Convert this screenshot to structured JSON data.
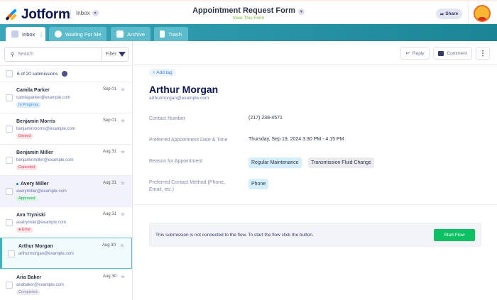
{
  "header": {
    "logo": "Jotform",
    "inbox_label": "Inbox",
    "form_title": "Appointment Request Form",
    "view_form": "View This Form",
    "share_label": "Share"
  },
  "tabs": [
    {
      "label": "Inbox"
    },
    {
      "label": "Waiting For Me"
    },
    {
      "label": "Archive"
    },
    {
      "label": "Trash"
    }
  ],
  "sidebar": {
    "search_placeholder": "Search",
    "filter_label": "Filter",
    "count_text": "6 of 20 submissions",
    "items": [
      {
        "name": "Camila Parker",
        "email": "camilaparker@example.com",
        "date": "Sep 01",
        "status": "In Progress",
        "status_bg": "#dcecfd",
        "status_color": "#4a8fe6"
      },
      {
        "name": "Benjamin Morris",
        "email": "benjaminmorris@example.com",
        "date": "Sep 01",
        "status": "Denied",
        "status_bg": "#fde3e6",
        "status_color": "#d94456"
      },
      {
        "name": "Benjamin Miller",
        "email": "benjaminmiller@example.com",
        "date": "Aug 31",
        "status": "Canceled",
        "status_bg": "#fde3e6",
        "status_color": "#d94456"
      },
      {
        "name": "Avery Miller",
        "email": "averymiller@example.com",
        "date": "Aug 31",
        "status": "Approved",
        "status_bg": "#d9f6e6",
        "status_color": "#1ea35a"
      },
      {
        "name": "Ava Tryniski",
        "email": "avatryniski@example.com",
        "date": "Aug 31",
        "status": "Error",
        "status_bg": "#fde3e6",
        "status_color": "#d94456"
      },
      {
        "name": "Arthur Morgan",
        "email": "arthurmorgan@example.com",
        "date": "Aug 30",
        "status": ""
      },
      {
        "name": "Aria Baker",
        "email": "ariabaker@example.com",
        "date": "Aug 30",
        "status": "Completed",
        "status_bg": "#ececf0",
        "status_color": "#8d8fa8"
      }
    ]
  },
  "toolbar": {
    "reply": "Reply",
    "comment": "Comment"
  },
  "detail": {
    "add_tag": "+ Add tag",
    "name": "Arthur Morgan",
    "email": "arthurmorgan@example.com",
    "fields": [
      {
        "label": "Contact Number",
        "value": "(217) 238-4571"
      },
      {
        "label": "Preferred Appointment Date & Time",
        "value": "Thursday, Sep 19, 2024 3:30 PM - 4:15 PM"
      },
      {
        "label": "Reason for Appointment",
        "chips": [
          "Regular Maintenance",
          "Transmission Fluid Change"
        ]
      },
      {
        "label": "Preferred Contact Method (Phone, Email, etc.)",
        "chips": [
          "Phone"
        ]
      }
    ],
    "flow_text": "This submission is not connected to the flow. To start the flow click the button.",
    "flow_button": "Start Flow"
  }
}
